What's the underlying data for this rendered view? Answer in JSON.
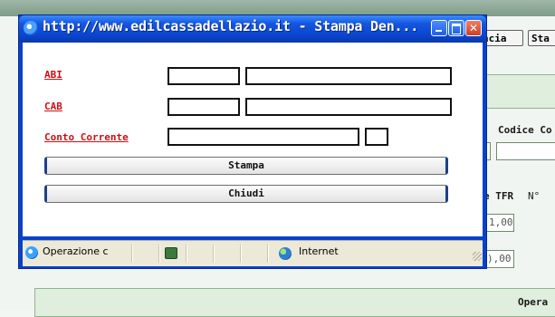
{
  "background": {
    "buttons": [
      "ncia",
      "Sta"
    ],
    "labels": {
      "codice": "Codice Co",
      "tfr": "e TFR",
      "number": "N°",
      "operations": "Opera"
    },
    "values": [
      "1,00",
      "),00"
    ]
  },
  "popup": {
    "title": "http://www.edilcassadellazio.it - Stampa Den...",
    "controls": {
      "minimize": "minimize-icon",
      "maximize": "maximize-icon",
      "close": "✕"
    },
    "fields": {
      "abi": "ABI",
      "cab": "CAB",
      "conto": "Conto Corrente"
    },
    "buttons": {
      "stampa": "Stampa",
      "chiudi": "Chiudi"
    },
    "statusbar": {
      "status": "Operazione c",
      "zone": "Internet"
    }
  },
  "colors": {
    "title_bar": "#0a44cf",
    "label_red": "#cc1010",
    "panel_green": "#dfeedd"
  }
}
